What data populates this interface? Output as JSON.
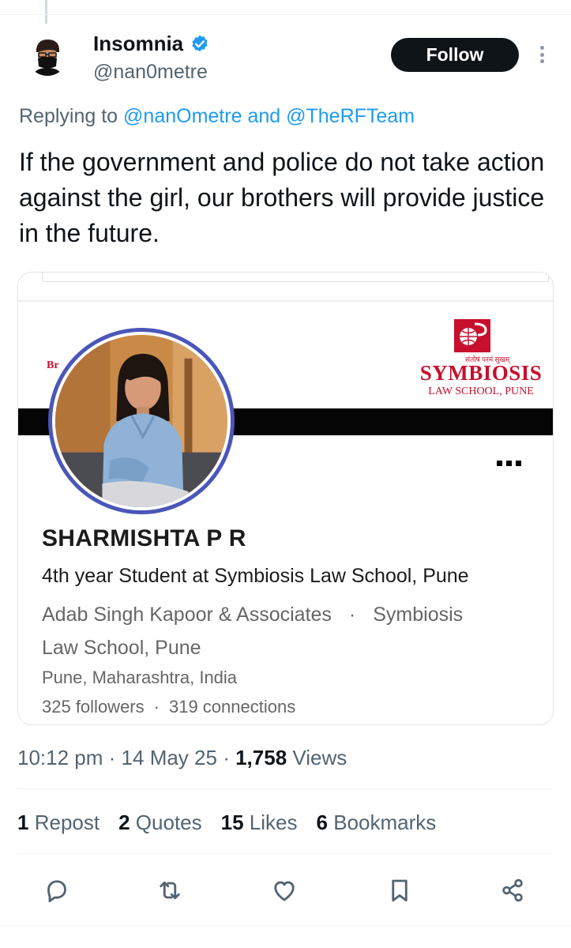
{
  "tweet": {
    "author": {
      "name": "Insomnia",
      "handle": "@nan0metre",
      "verified": true
    },
    "follow_label": "Follow",
    "replying": {
      "prefix": "Replying to",
      "mention1": "@nanOmetre",
      "joiner": "and",
      "mention2": "@TheRFTeam"
    },
    "text": "If the government and police do not take action against the girl, our brothers will provide justice in the future.",
    "media": {
      "banner_fragment": "Br",
      "logo_small_text": "संतोषं परमं सुखम्",
      "logo_title": "SYMBIOSIS",
      "logo_subtitle": "LAW SCHOOL, PUNE",
      "profile_name": "SHARMISHTA P R",
      "headline": "4th year Student at Symbiosis Law School, Pune",
      "company": "Adab Singh Kapoor & Associates",
      "company_sep": "·",
      "school_line1": "Symbiosis",
      "school_line2": "Law School, Pune",
      "location": "Pune, Maharashtra, India",
      "followers": "325 followers",
      "counts_sep": "·",
      "connections": "319 connections"
    },
    "meta": {
      "time": "10:12 pm",
      "sep": "·",
      "date": "14 May 25",
      "views_count": "1,758",
      "views_label": "Views"
    },
    "stats": {
      "reposts_count": "1",
      "reposts_label": "Repost",
      "quotes_count": "2",
      "quotes_label": "Quotes",
      "likes_count": "15",
      "likes_label": "Likes",
      "bookmarks_count": "6",
      "bookmarks_label": "Bookmarks"
    },
    "actions": [
      "reply-icon",
      "repost-icon",
      "like-icon",
      "bookmark-icon",
      "share-icon"
    ]
  },
  "colors": {
    "accent": "#1d9bf0",
    "text": "#0f1419",
    "secondary": "#536471",
    "brand_red": "#c8102e",
    "ring": "#4a56b8"
  }
}
